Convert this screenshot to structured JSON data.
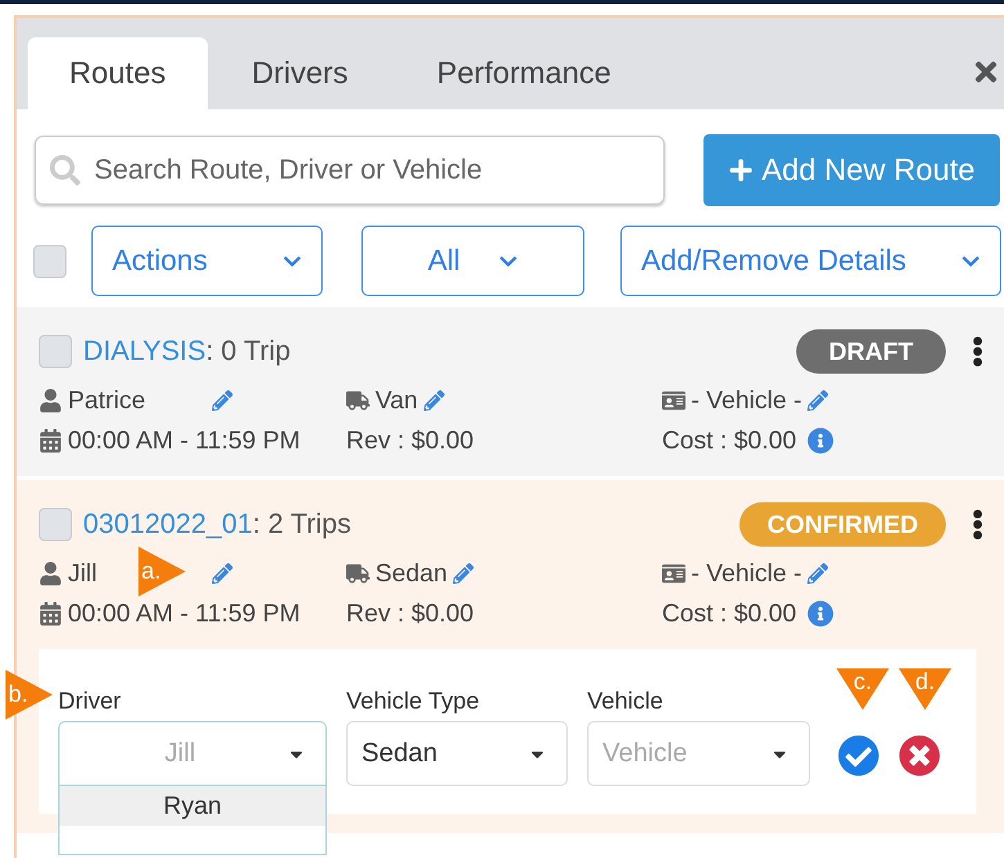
{
  "tabs": [
    {
      "label": "Routes",
      "selected": true
    },
    {
      "label": "Drivers",
      "selected": false
    },
    {
      "label": "Performance",
      "selected": false
    }
  ],
  "search": {
    "placeholder": "Search Route, Driver or Vehicle"
  },
  "add_button": "Add New Route",
  "select_all": {
    "checked": false
  },
  "filters": [
    {
      "label": "Actions"
    },
    {
      "label": "All"
    },
    {
      "label": "Add/Remove Details"
    }
  ],
  "routes": [
    {
      "name": "DIALYSIS",
      "trips": ": 0 Trip",
      "status": "DRAFT",
      "color": "#6e6e6e",
      "checked": false,
      "driver": "Patrice",
      "vehicle_type": "Van",
      "vehicle": "- Vehicle -",
      "time": "00:00 AM - 11:59 PM",
      "rev": "Rev : $0.00",
      "cost": "Cost : $0.00"
    },
    {
      "name": "03012022_01",
      "trips": ": 2 Trips",
      "status": "CONFIRMED",
      "color": "#e8a534",
      "checked": false,
      "driver": "Jill",
      "vehicle_type": "Sedan",
      "vehicle": "- Vehicle -",
      "time": "00:00 AM - 11:59 PM",
      "rev": "Rev : $0.00",
      "cost": "Cost : $0.00",
      "driver_annotation": {
        "label": "a.",
        "kind": "right"
      },
      "editor": {
        "fields": [
          {
            "label": "Driver",
            "value": "Jill",
            "open": true,
            "options": [
              {
                "label": "Ryan",
                "selected": true
              }
            ],
            "annotation": {
              "label": "b.",
              "kind": "right"
            }
          },
          {
            "label": "Vehicle Type",
            "value": "Sedan",
            "open": false
          },
          {
            "label": "Vehicle",
            "placeholder": "Vehicle",
            "open": false
          }
        ],
        "confirm_annotation": {
          "label": "c.",
          "kind": "down"
        },
        "cancel_annotation": {
          "label": "d.",
          "kind": "down"
        }
      }
    }
  ]
}
